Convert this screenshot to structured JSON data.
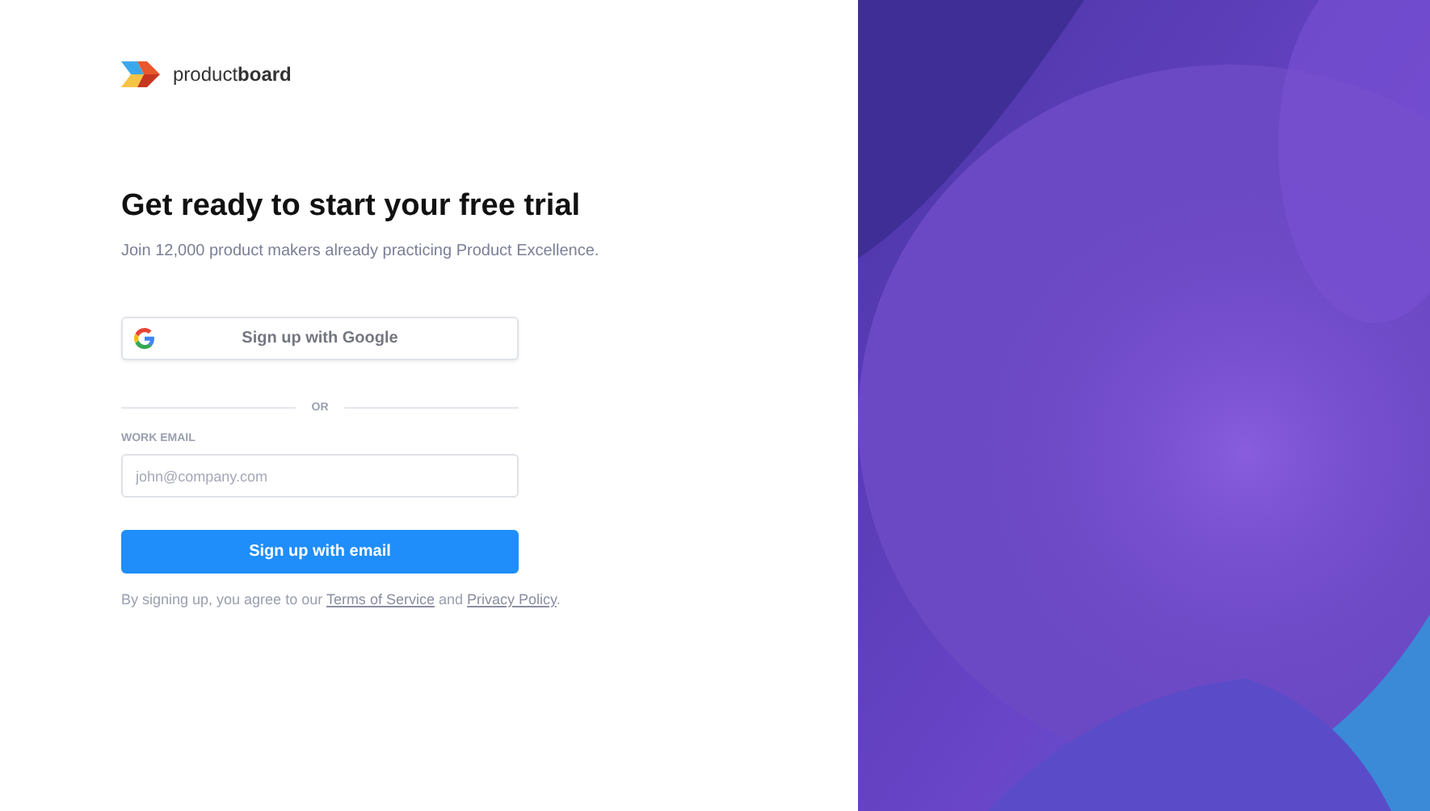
{
  "brand": {
    "name": "product**board**"
  },
  "heading": "Get ready to start your free trial",
  "subtitle": "Join 12,000 product makers already practicing Product Excellence.",
  "google_button": {
    "label": "Sign up with Google"
  },
  "divider": {
    "label": "OR"
  },
  "email_field": {
    "label": "WORK EMAIL",
    "placeholder": "john@company.com"
  },
  "email_button": {
    "label": "Sign up with email"
  },
  "legal": [
    {
      "kind": "text",
      "text": "By signing up, you agree to our"
    },
    {
      "kind": "link",
      "text": "Terms of Service"
    },
    {
      "kind": "text",
      "text": "and"
    },
    {
      "kind": "link",
      "text": "Privacy Policy"
    },
    {
      "kind": "text",
      "text": "."
    }
  ]
}
